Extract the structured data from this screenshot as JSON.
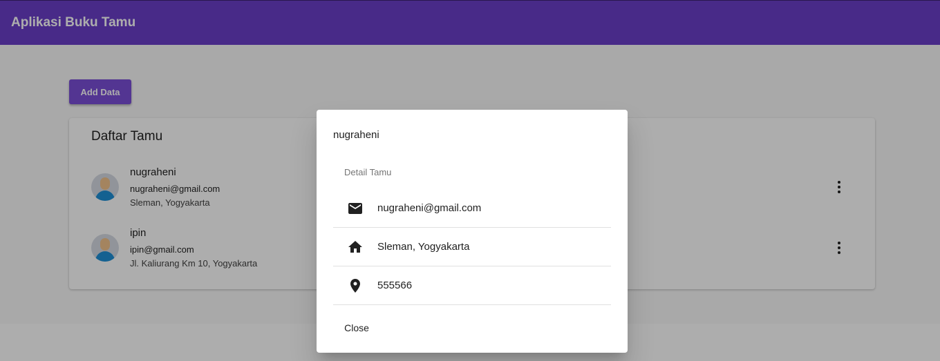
{
  "appbar": {
    "title": "Aplikasi Buku Tamu",
    "color": "#6a3fc9"
  },
  "toolbar": {
    "add_label": "Add Data"
  },
  "guest_list": {
    "title": "Daftar Tamu",
    "items": [
      {
        "name": "nugraheni",
        "email": "nugraheni@gmail.com",
        "address": "Sleman, Yogyakarta"
      },
      {
        "name": "ipin",
        "email": "ipin@gmail.com",
        "address": "Jl. Kaliurang Km 10, Yogyakarta"
      }
    ]
  },
  "dialog": {
    "title": "nugraheni",
    "subheader": "Detail Tamu",
    "rows": [
      {
        "icon": "mail-icon",
        "value": "nugraheni@gmail.com"
      },
      {
        "icon": "home-icon",
        "value": "Sleman, Yogyakarta"
      },
      {
        "icon": "location-pin-icon",
        "value": "555566"
      }
    ],
    "close_label": "Close"
  }
}
